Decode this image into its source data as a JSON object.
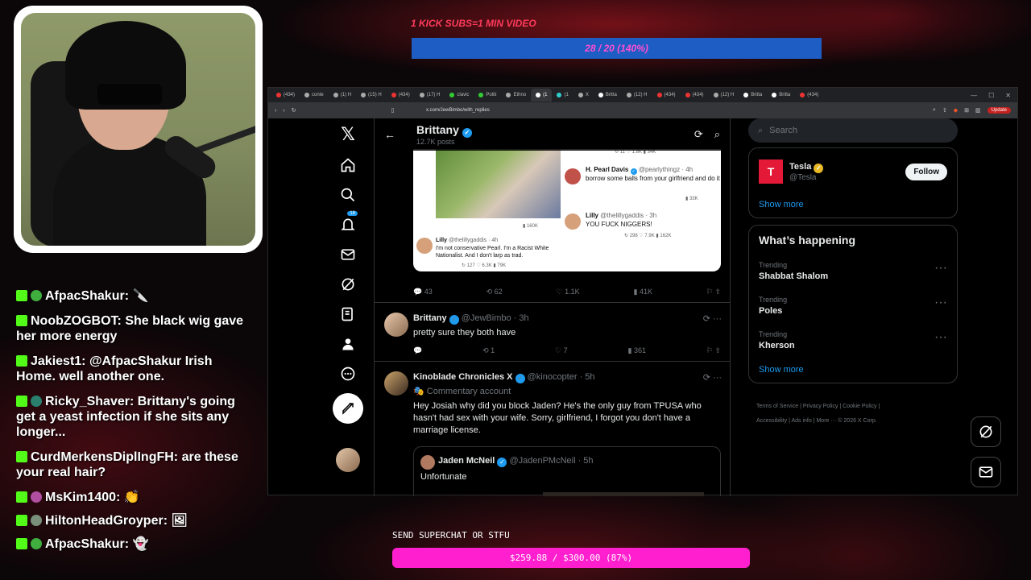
{
  "overlay": {
    "kick_goal_label": "1 KICK SUBS=1 MIN VIDEO",
    "kick_goal_progress": "28 / 20 (140%)",
    "superchat_label": "SEND SUPERCHAT OR STFU",
    "superchat_progress": "$259.88 / $300.00 (87%)",
    "superchat_fraction": 0.87
  },
  "chat": [
    {
      "user": "AfpacShakur:",
      "text": "🔪",
      "color": "#3fae3f"
    },
    {
      "user": "NoobZOGBOT:",
      "text": " She black wig gave her more energy",
      "color": ""
    },
    {
      "user": "Jakiest1:",
      "text": " @AfpacShakur Irish Home. well another one.",
      "color": ""
    },
    {
      "user": "Ricky_Shaver:",
      "text": " Brittany's going get a yeast infection if she sits any longer...",
      "color": "#2a7f6f"
    },
    {
      "user": "CurdMerkensDiplIngFH:",
      "text": " are these your real hair?",
      "color": ""
    },
    {
      "user": "MsKim1400:",
      "text": " 👏",
      "color": "#b04fa0"
    },
    {
      "user": "HiltonHeadGroyper:",
      "text": " 🖼",
      "color": "#7a8f7a"
    },
    {
      "user": "AfpacShakur:",
      "text": " 👻",
      "color": "#3fae3f"
    }
  ],
  "browser": {
    "tabs": [
      "(434)",
      "conte",
      "(1) H",
      "(15) H",
      "(434)",
      "(17) H",
      "clavic",
      "Politi",
      "Ethno",
      "(1",
      "(1",
      "X",
      "Britta",
      "(12) H",
      "(434)",
      "(434)",
      "(12) H",
      "Britta",
      "Britta",
      "(434)"
    ],
    "url": "x.com/JewBimbo/with_replies",
    "update_label": "Update"
  },
  "profile": {
    "name": "Brittany",
    "posts": "12.7K posts"
  },
  "nav": {
    "notifications_badge": "18"
  },
  "embedded": {
    "pearl_name": "H. Pearl Davis",
    "pearl_handle": "@pearlythingz · 4h",
    "pearl_text": "borrow some balls from your girlfriend and do it",
    "lilly_name": "Lilly",
    "lilly_handle": "@thelillygaddis · 3h",
    "lilly_text": "YOU FUCK NIGGERS!",
    "lilly2_handle": "@thelillygaddis · 4h",
    "lilly2_text": "I'm not conservative Pearl. I'm a Racist White Nationalist. And I don't larp as trad."
  },
  "post_actions": {
    "replies": "43",
    "reposts": "62",
    "likes": "1.1K",
    "views": "41K"
  },
  "tweets": [
    {
      "name": "Brittany",
      "handle": "@JewBimbo · 3h",
      "text": "pretty sure they both have",
      "replies": "",
      "reposts": "1",
      "likes": "7",
      "views": "361"
    },
    {
      "name": "Kinoblade Chronicles X",
      "handle": "@kinocopter · 5h",
      "label": "Commentary account",
      "text": "Hey Josiah why did you block Jaden? He's the only guy from TPUSA who hasn't had sex with your wife. Sorry, girlfriend, I forgot you don't have a marriage license.",
      "quote_name": "Jaden McNeil",
      "quote_handle": "@JadenPMcNeil · 5h",
      "quote_text": "Unfortunate"
    }
  ],
  "sidebar": {
    "search_placeholder": "Search",
    "suggest_name": "Tesla",
    "suggest_handle": "@Tesla",
    "follow_label": "Follow",
    "show_more": "Show more",
    "happening_title": "What’s happening",
    "trends": [
      {
        "label": "Trending",
        "topic": "Shabbat Shalom"
      },
      {
        "label": "Trending",
        "topic": "Poles"
      },
      {
        "label": "Trending",
        "topic": "Kherson"
      }
    ],
    "footer": [
      "Terms of Service",
      "Privacy Policy",
      "Cookie Policy",
      "Accessibility",
      "Ads info",
      "More ···",
      "© 2026 X Corp."
    ]
  }
}
